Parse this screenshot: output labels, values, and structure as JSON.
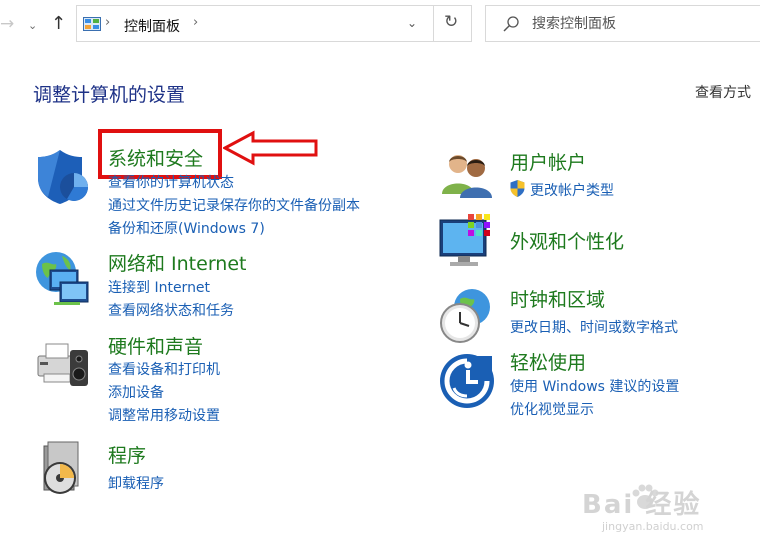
{
  "nav": {
    "forward_glyph": "→",
    "recent_glyph": "⌄",
    "up_glyph": "↑",
    "sep_glyph": "›",
    "dropdown_glyph": "⌄",
    "refresh_glyph": "↻"
  },
  "address": {
    "crumb": "控制面板"
  },
  "search": {
    "placeholder": "搜索控制面板"
  },
  "header": {
    "title": "调整计算机的设置",
    "view_by": "查看方式"
  },
  "categories": [
    {
      "id": "system-security",
      "title": "系统和安全",
      "links": [
        "查看你的计算机状态",
        "通过文件历史记录保存你的文件备份副本",
        "备份和还原(Windows 7)"
      ]
    },
    {
      "id": "network",
      "title": "网络和 Internet",
      "links": [
        "连接到 Internet",
        "查看网络状态和任务"
      ]
    },
    {
      "id": "hardware",
      "title": "硬件和声音",
      "links": [
        "查看设备和打印机",
        "添加设备",
        "调整常用移动设置"
      ]
    },
    {
      "id": "programs",
      "title": "程序",
      "links": [
        "卸载程序"
      ]
    },
    {
      "id": "user-accounts",
      "title": "用户帐户",
      "links": [
        "更改帐户类型"
      ]
    },
    {
      "id": "appearance",
      "title": "外观和个性化",
      "links": []
    },
    {
      "id": "clock-region",
      "title": "时钟和区域",
      "links": [
        "更改日期、时间或数字格式"
      ]
    },
    {
      "id": "ease-of-access",
      "title": "轻松使用",
      "links": [
        "使用 Windows 建议的设置",
        "优化视觉显示"
      ]
    }
  ],
  "watermark": {
    "brand": "Bai 经验",
    "url": "jingyan.baidu.com"
  },
  "colors": {
    "title_blue": "#1e3287",
    "category_green": "#1e7a1e",
    "link_blue": "#1a5fb4",
    "highlight_red": "#e01010"
  }
}
